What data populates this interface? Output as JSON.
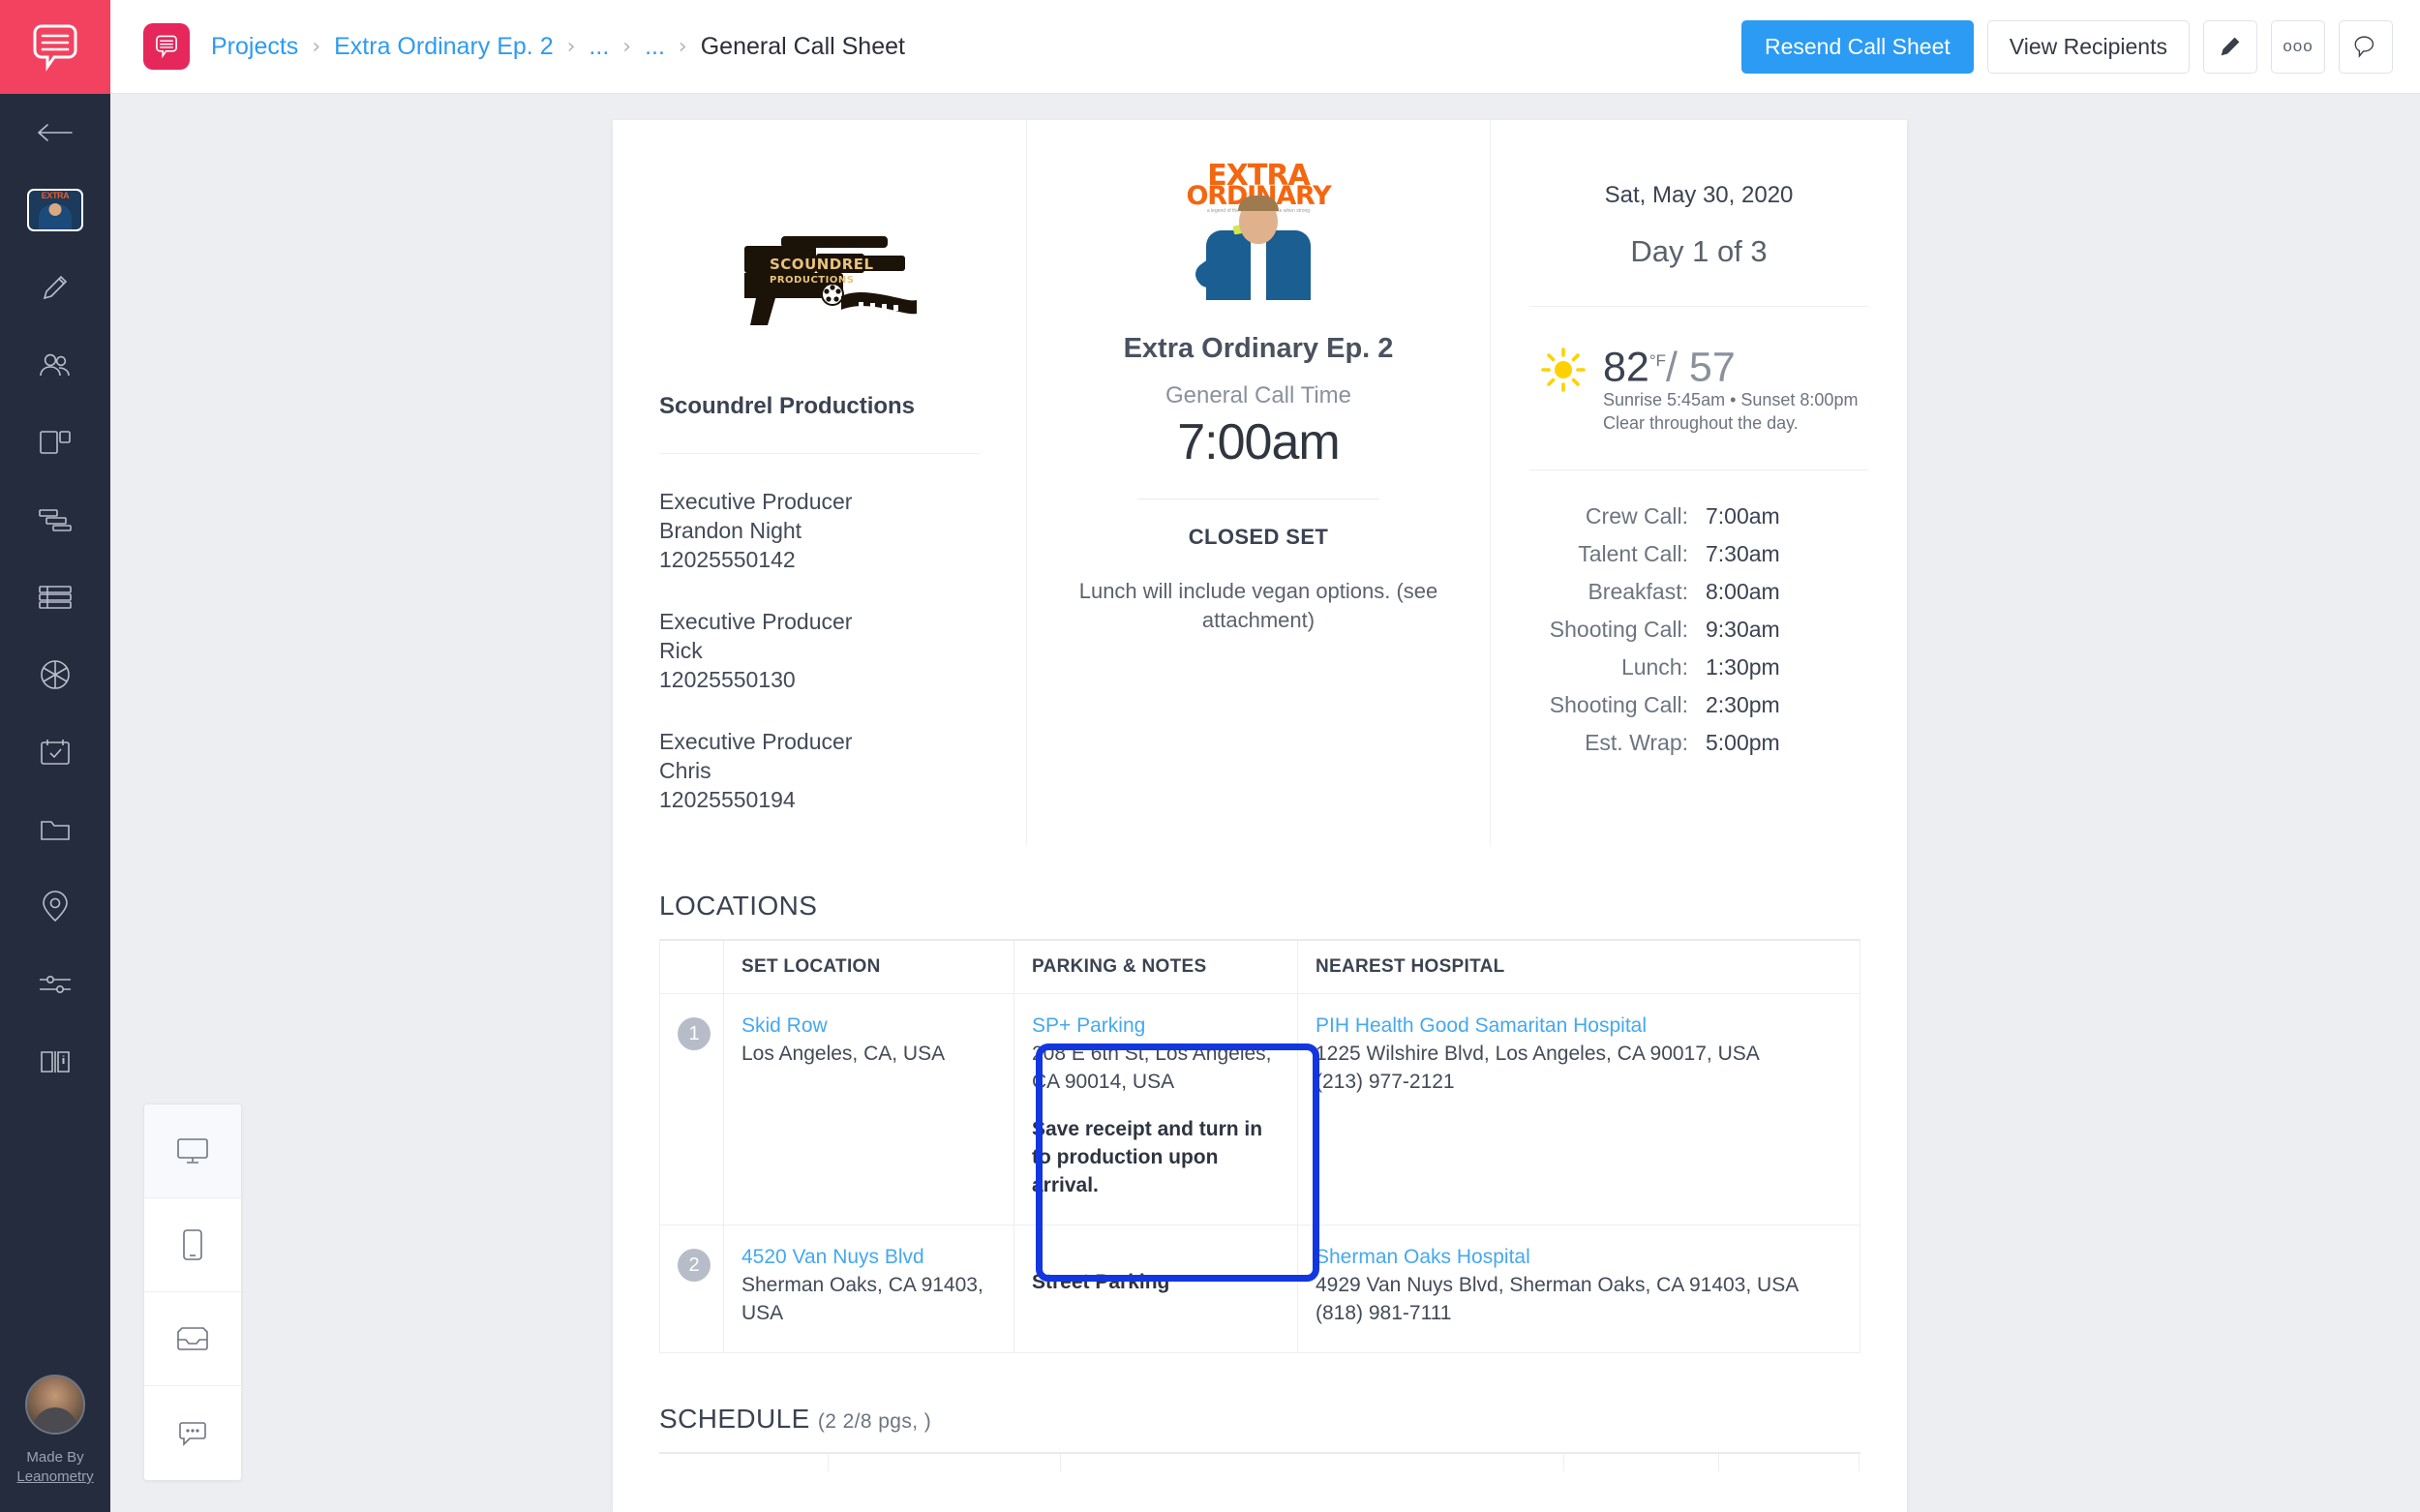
{
  "brand": {
    "accent_pink": "#f2425f",
    "accent_blue": "#2b9bf4",
    "rail_bg": "#252c3d",
    "highlight_blue": "#1236e0"
  },
  "rail": {
    "made_by_line1": "Made By",
    "made_by_line2": "Leanometry",
    "items": [
      {
        "name": "back-arrow-icon",
        "label": "Back"
      },
      {
        "name": "project-thumbnail",
        "label": "Extra Ordinary"
      },
      {
        "name": "pencil-icon",
        "label": "Edit"
      },
      {
        "name": "team-icon",
        "label": "Team"
      },
      {
        "name": "layout-icon",
        "label": "Layout"
      },
      {
        "name": "gantt-icon",
        "label": "Schedule"
      },
      {
        "name": "rows-icon",
        "label": "Stripboard"
      },
      {
        "name": "aperture-icon",
        "label": "Shots"
      },
      {
        "name": "calendar-check-icon",
        "label": "Calendar"
      },
      {
        "name": "folder-icon",
        "label": "Files"
      },
      {
        "name": "pin-icon",
        "label": "Locations"
      },
      {
        "name": "sliders-icon",
        "label": "Settings"
      },
      {
        "name": "book-info-icon",
        "label": "Guide"
      }
    ]
  },
  "topbar": {
    "breadcrumbs": [
      {
        "label": "Projects",
        "current": false
      },
      {
        "label": "Extra Ordinary Ep. 2",
        "current": false
      },
      {
        "label": "...",
        "current": false
      },
      {
        "label": "...",
        "current": false
      },
      {
        "label": "General Call Sheet",
        "current": true
      }
    ],
    "separator": "›",
    "resend_label": "Resend Call Sheet",
    "recipients_label": "View Recipients",
    "icon_buttons": [
      "pencil-icon",
      "more-dots-icon",
      "comment-icon"
    ],
    "more_dots": "ooo"
  },
  "view_switch": {
    "items": [
      {
        "name": "desktop-view",
        "active": true
      },
      {
        "name": "mobile-view",
        "active": false
      },
      {
        "name": "inbox-view",
        "active": false
      },
      {
        "name": "comments-view",
        "active": false
      }
    ]
  },
  "sheet": {
    "production": {
      "logo_text_line1": "SCOUNDREL",
      "logo_text_line2": "PRODUCTIONS",
      "company": "Scoundrel Productions",
      "contacts": [
        {
          "role": "Executive Producer",
          "name": "Brandon Night",
          "phone": "12025550142"
        },
        {
          "role": "Executive Producer",
          "name": "Rick",
          "phone": "12025550130"
        },
        {
          "role": "Executive Producer",
          "name": "Chris",
          "phone": "12025550194"
        }
      ]
    },
    "center": {
      "art_title": "EXTRA",
      "art_subtitle": "ORDINARY",
      "art_tagline": "a legend of the ordinary and dislike when strong",
      "show_title": "Extra Ordinary Ep. 2",
      "call_time_label": "General Call Time",
      "call_time": "7:00am",
      "closed_set": "CLOSED SET",
      "note": "Lunch will include vegan options. (see attachment)"
    },
    "right": {
      "date": "Sat, May 30, 2020",
      "day_of": "Day 1 of 3",
      "weather": {
        "icon": "sun-icon",
        "high": "82",
        "degree_unit": "°F",
        "low": "/ 57",
        "sun_line": "Sunrise 5:45am • Sunset 8:00pm",
        "condition": "Clear throughout the day."
      },
      "calls": [
        {
          "label": "Crew Call:",
          "time": "7:00am"
        },
        {
          "label": "Talent Call:",
          "time": "7:30am"
        },
        {
          "label": "Breakfast:",
          "time": "8:00am"
        },
        {
          "label": "Shooting Call:",
          "time": "9:30am"
        },
        {
          "label": "Lunch:",
          "time": "1:30pm"
        },
        {
          "label": "Shooting Call:",
          "time": "2:30pm"
        },
        {
          "label": "Est. Wrap:",
          "time": "5:00pm"
        }
      ]
    },
    "locations": {
      "section_title": "LOCATIONS",
      "headers": {
        "num": "",
        "set": "SET LOCATION",
        "parking": "PARKING & NOTES",
        "hospital": "NEAREST HOSPITAL"
      },
      "rows": [
        {
          "num": "1",
          "set_name": "Skid Row",
          "set_address": "Los Angeles, CA, USA",
          "parking_name": "SP+ Parking",
          "parking_address": "208 E 6th St, Los Angeles, CA 90014, USA",
          "parking_note": "Save receipt and turn in to production upon arrival.",
          "hospital_name": "PIH Health Good Samaritan Hospital",
          "hospital_address": "1225 Wilshire Blvd, Los Angeles, CA 90017, USA",
          "hospital_phone": "(213) 977-2121"
        },
        {
          "num": "2",
          "set_name": "4520 Van Nuys Blvd",
          "set_address": "Sherman Oaks, CA 91403, USA",
          "parking_name": "",
          "parking_address": "",
          "parking_note": "Street Parking",
          "hospital_name": "Sherman Oaks Hospital",
          "hospital_address": "4929 Van Nuys Blvd, Sherman Oaks, CA 91403, USA",
          "hospital_phone": "(818) 981-7111"
        }
      ]
    },
    "schedule": {
      "section_title": "SCHEDULE",
      "pages": "(2 2/8 pgs, )"
    }
  }
}
